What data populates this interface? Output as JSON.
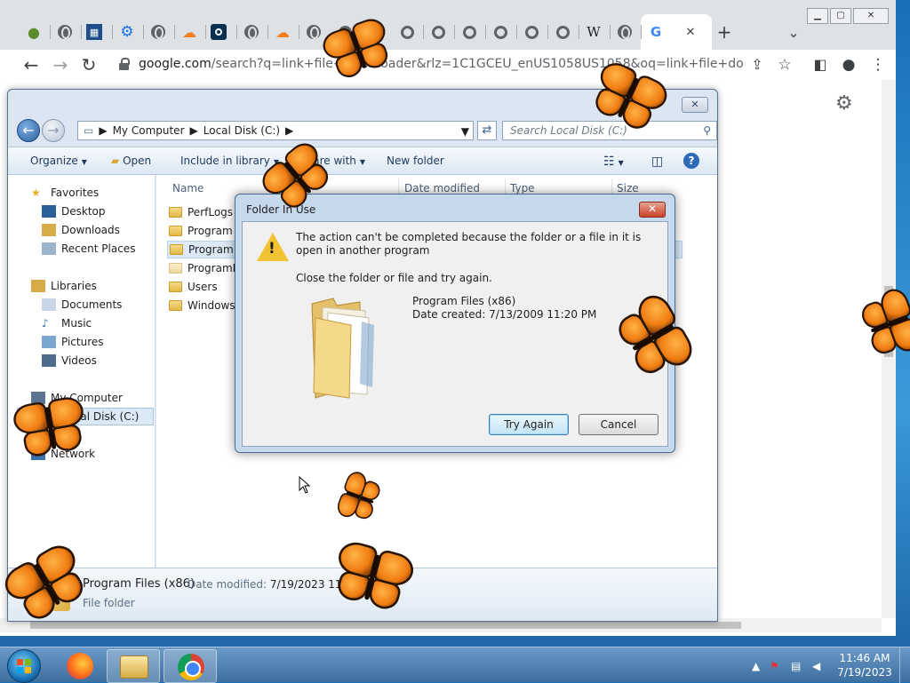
{
  "browser": {
    "tabs": [
      {
        "icon": "frog-icon"
      },
      {
        "icon": "globe-icon"
      },
      {
        "icon": "chart-icon"
      },
      {
        "icon": "gear-blue-icon"
      },
      {
        "icon": "globe-icon"
      },
      {
        "icon": "cloudflare-icon"
      },
      {
        "icon": "target-icon"
      },
      {
        "icon": "globe-icon"
      },
      {
        "icon": "cloudflare-icon"
      },
      {
        "icon": "globe-icon"
      },
      {
        "icon": "chrome-icon"
      },
      {
        "icon": "chrome-icon"
      },
      {
        "icon": "chrome-icon"
      },
      {
        "icon": "chrome-icon"
      },
      {
        "icon": "chrome-icon"
      },
      {
        "icon": "chrome-icon"
      },
      {
        "icon": "wikipedia-icon"
      },
      {
        "icon": "globe-icon"
      },
      {
        "icon": "google-icon"
      }
    ],
    "wiki_glyph": "W",
    "google_glyph": "G",
    "new_tab_glyph": "+",
    "close_tab_glyph": "✕",
    "tab_list_glyph": "⌄",
    "url_host": "google.com",
    "url_rest": "/search?q=link+file+downloader&rlz=1C1GCEU_enUS1058US1058&oq=link+file+downloader&..."
  },
  "explorer": {
    "breadcrumb": [
      "My Computer",
      "Local Disk (C:)"
    ],
    "search_placeholder": "Search Local Disk (C:)",
    "toolbar": {
      "organize": "Organize",
      "open": "Open",
      "include": "Include in library",
      "share": "Share with",
      "new_folder": "New folder"
    },
    "nav": {
      "favorites": "Favorites",
      "desktop": "Desktop",
      "downloads": "Downloads",
      "recent": "Recent Places",
      "libraries": "Libraries",
      "documents": "Documents",
      "music": "Music",
      "pictures": "Pictures",
      "videos": "Videos",
      "computer": "My Computer",
      "disk": "Local Disk (C:)",
      "network": "Network"
    },
    "columns": {
      "name": "Name",
      "date": "Date modified",
      "type": "Type",
      "size": "Size"
    },
    "files": [
      "PerfLogs",
      "Program Files",
      "Program Files (x86)",
      "ProgramData",
      "Users",
      "Windows"
    ],
    "details": {
      "name": "Program Files (x86)",
      "modified_label": "Date modified:",
      "modified_value": "7/19/2023 11:17 AM",
      "type": "File folder"
    }
  },
  "dialog": {
    "title": "Folder In Use",
    "message": "The action can't be completed because the folder or a file in it is open in another program",
    "hint": "Close the folder or file and try again.",
    "folder_name": "Program Files (x86)",
    "date_created": "Date created: 7/13/2009 11:20 PM",
    "try_again": "Try Again",
    "cancel": "Cancel"
  },
  "taskbar": {
    "apps": [
      "firefox-icon",
      "explorer-icon",
      "chrome-icon"
    ],
    "time": "11:46 AM",
    "date": "7/19/2023"
  }
}
